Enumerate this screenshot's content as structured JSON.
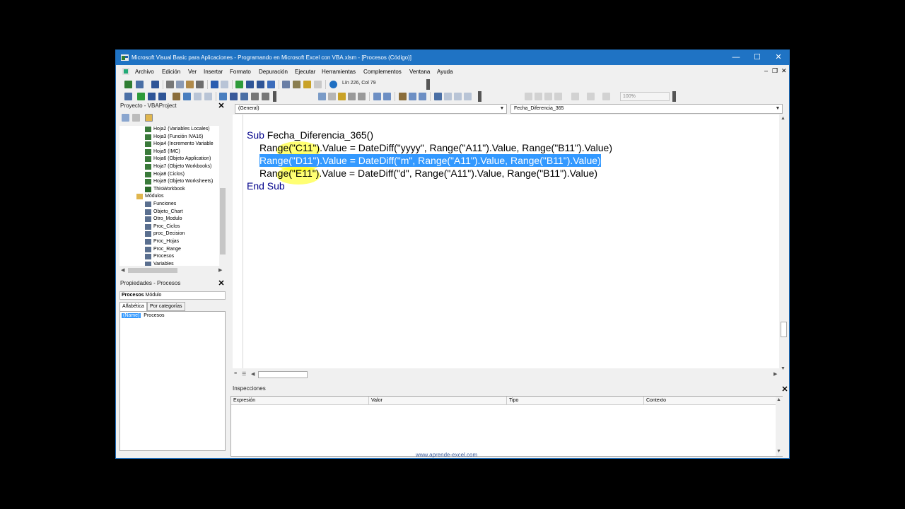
{
  "titlebar": {
    "title": "Microsoft Visual Basic para Aplicaciones - Programando en Microsoft Excel con VBA.xlsm - [Procesos (Código)]",
    "minimize": "—",
    "maximize": "☐",
    "close": "✕"
  },
  "menu": {
    "items": [
      "Archivo",
      "Edición",
      "Ver",
      "Insertar",
      "Formato",
      "Depuración",
      "Ejecutar",
      "Herramientas",
      "Complementos",
      "Ventana",
      "Ayuda"
    ],
    "mdi_minimize": "–",
    "mdi_restore": "❐",
    "mdi_close": "✕"
  },
  "toolbar": {
    "position": "Lín 226, Col 79",
    "zoom": "100%"
  },
  "project": {
    "title": "Proyecto - VBAProject",
    "close": "✕",
    "tree": [
      {
        "label": "Hoja2 (Variables Locales)",
        "type": "sheet"
      },
      {
        "label": "Hoja3 (Función IVA16)",
        "type": "sheet"
      },
      {
        "label": "Hoja4 (Incremento Variable",
        "type": "sheet"
      },
      {
        "label": "Hoja5 (IMC)",
        "type": "sheet"
      },
      {
        "label": "Hoja6 (Objeto Application)",
        "type": "sheet"
      },
      {
        "label": "Hoja7 (Objeto Workbooks)",
        "type": "sheet"
      },
      {
        "label": "Hoja8 (Ciclos)",
        "type": "sheet"
      },
      {
        "label": "Hoja9 (Objeto Worksheets)",
        "type": "sheet"
      },
      {
        "label": "ThisWorkbook",
        "type": "workbook"
      },
      {
        "label": "Módulos",
        "type": "folder"
      },
      {
        "label": "Funciones",
        "type": "module"
      },
      {
        "label": "Objeto_Chart",
        "type": "module"
      },
      {
        "label": "Otro_Modulo",
        "type": "module"
      },
      {
        "label": "Proc_Ciclos",
        "type": "module"
      },
      {
        "label": "proc_Decision",
        "type": "module"
      },
      {
        "label": "Proc_Hojas",
        "type": "module"
      },
      {
        "label": "Proc_Range",
        "type": "module"
      },
      {
        "label": "Procesos",
        "type": "module"
      },
      {
        "label": "Variables",
        "type": "module"
      }
    ]
  },
  "properties": {
    "title": "Propiedades - Procesos",
    "close": "✕",
    "object_name": "Procesos",
    "object_type": "Módulo",
    "tabs": [
      "Alfabética",
      "Por categorías"
    ],
    "rows": [
      {
        "name": "(Name)",
        "value": "Procesos"
      }
    ]
  },
  "code": {
    "object_combo": "(General)",
    "proc_combo": "Fecha_Diferencia_365",
    "line1_kw": "Sub",
    "line1_rest": " Fecha_Diferencia_365()",
    "line2": "Range(\"C11\").Value = DateDiff(\"yyyy\", Range(\"A11\").Value, Range(\"B11\").Value)",
    "line3": "Range(\"D11\").Value = DateDiff(\"m\", Range(\"A11\").Value, Range(\"B11\").Value)",
    "line4": "Range(\"E11\").Value = DateDiff(\"d\", Range(\"A11\").Value, Range(\"B11\").Value)",
    "line5": "End Sub"
  },
  "watch": {
    "title": "Inspecciones",
    "close": "✕",
    "columns": [
      "Expresión",
      "Valor",
      "Tipo",
      "Contexto"
    ]
  },
  "watermark": "www.aprende-excel.com",
  "colors": {
    "titlebar": "#1f73c4",
    "keyword": "#00008b",
    "selection": "#3399ff",
    "highlighter": "#ffff00"
  }
}
